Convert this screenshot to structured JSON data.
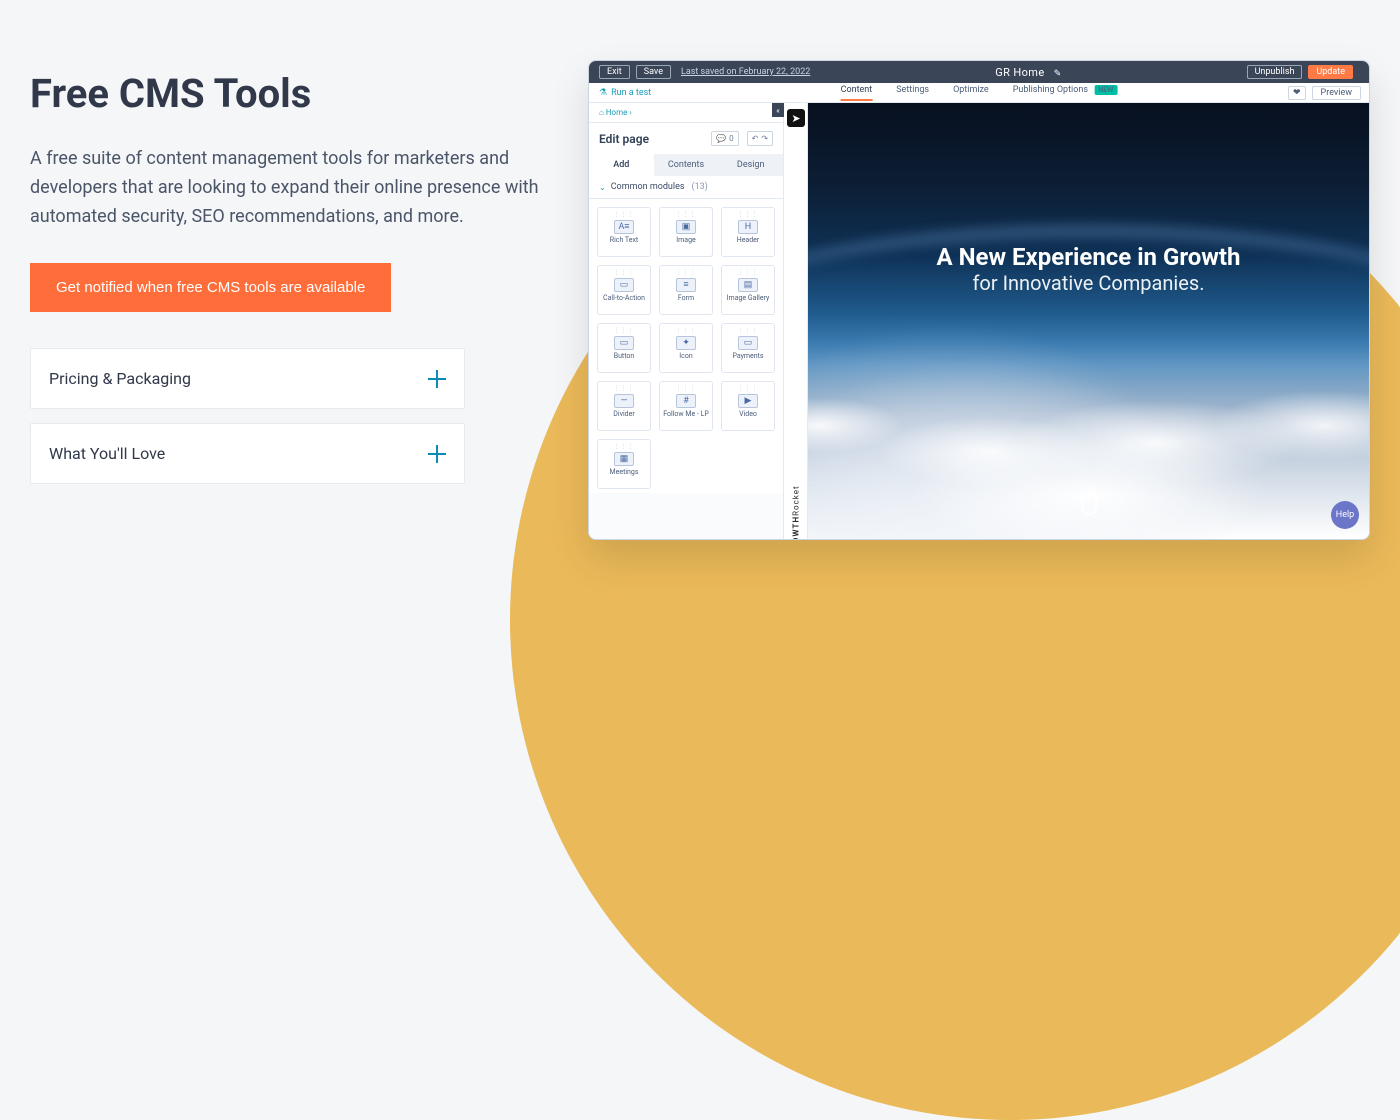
{
  "left": {
    "title": "Free CMS Tools",
    "subtitle": "A free suite of content management tools for marketers and developers that are looking to expand their online presence with automated security, SEO recommendations, and more.",
    "cta": "Get notified when free CMS tools are available",
    "accordion": [
      "Pricing & Packaging",
      "What You'll Love"
    ]
  },
  "topbar": {
    "exit": "Exit",
    "save": "Save",
    "saved": "Last saved on February 22, 2022",
    "title": "GR Home",
    "unpublish": "Unpublish",
    "update": "Update"
  },
  "subbar": {
    "run": "Run a test",
    "tabs": [
      "Content",
      "Settings",
      "Optimize",
      "Publishing Options"
    ],
    "badge": "NEW",
    "preview": "Preview"
  },
  "editor": {
    "breadcrumb_home": "Home",
    "heading": "Edit page",
    "count_value": "0",
    "tabs": [
      "Add",
      "Contents",
      "Design"
    ],
    "section_label": "Common modules",
    "section_count": "(13)",
    "modules": [
      "Rich Text",
      "Image",
      "Header",
      "Call-to-Action",
      "Form",
      "Image Gallery",
      "Button",
      "Icon",
      "Payments",
      "Divider",
      "Follow Me - LP",
      "Video",
      "Meetings"
    ],
    "brand_bold": "GROWTH",
    "brand_light": "Rocket"
  },
  "hero": {
    "l1": "A New Experience in Growth",
    "l2": "for Innovative Companies."
  },
  "help": "Help",
  "icons": {
    "modules": [
      "A≡",
      "▣",
      "H",
      "▭",
      "≡",
      "▤",
      "▭",
      "✦",
      "▭",
      "—",
      "#",
      "▶",
      "▦"
    ]
  }
}
